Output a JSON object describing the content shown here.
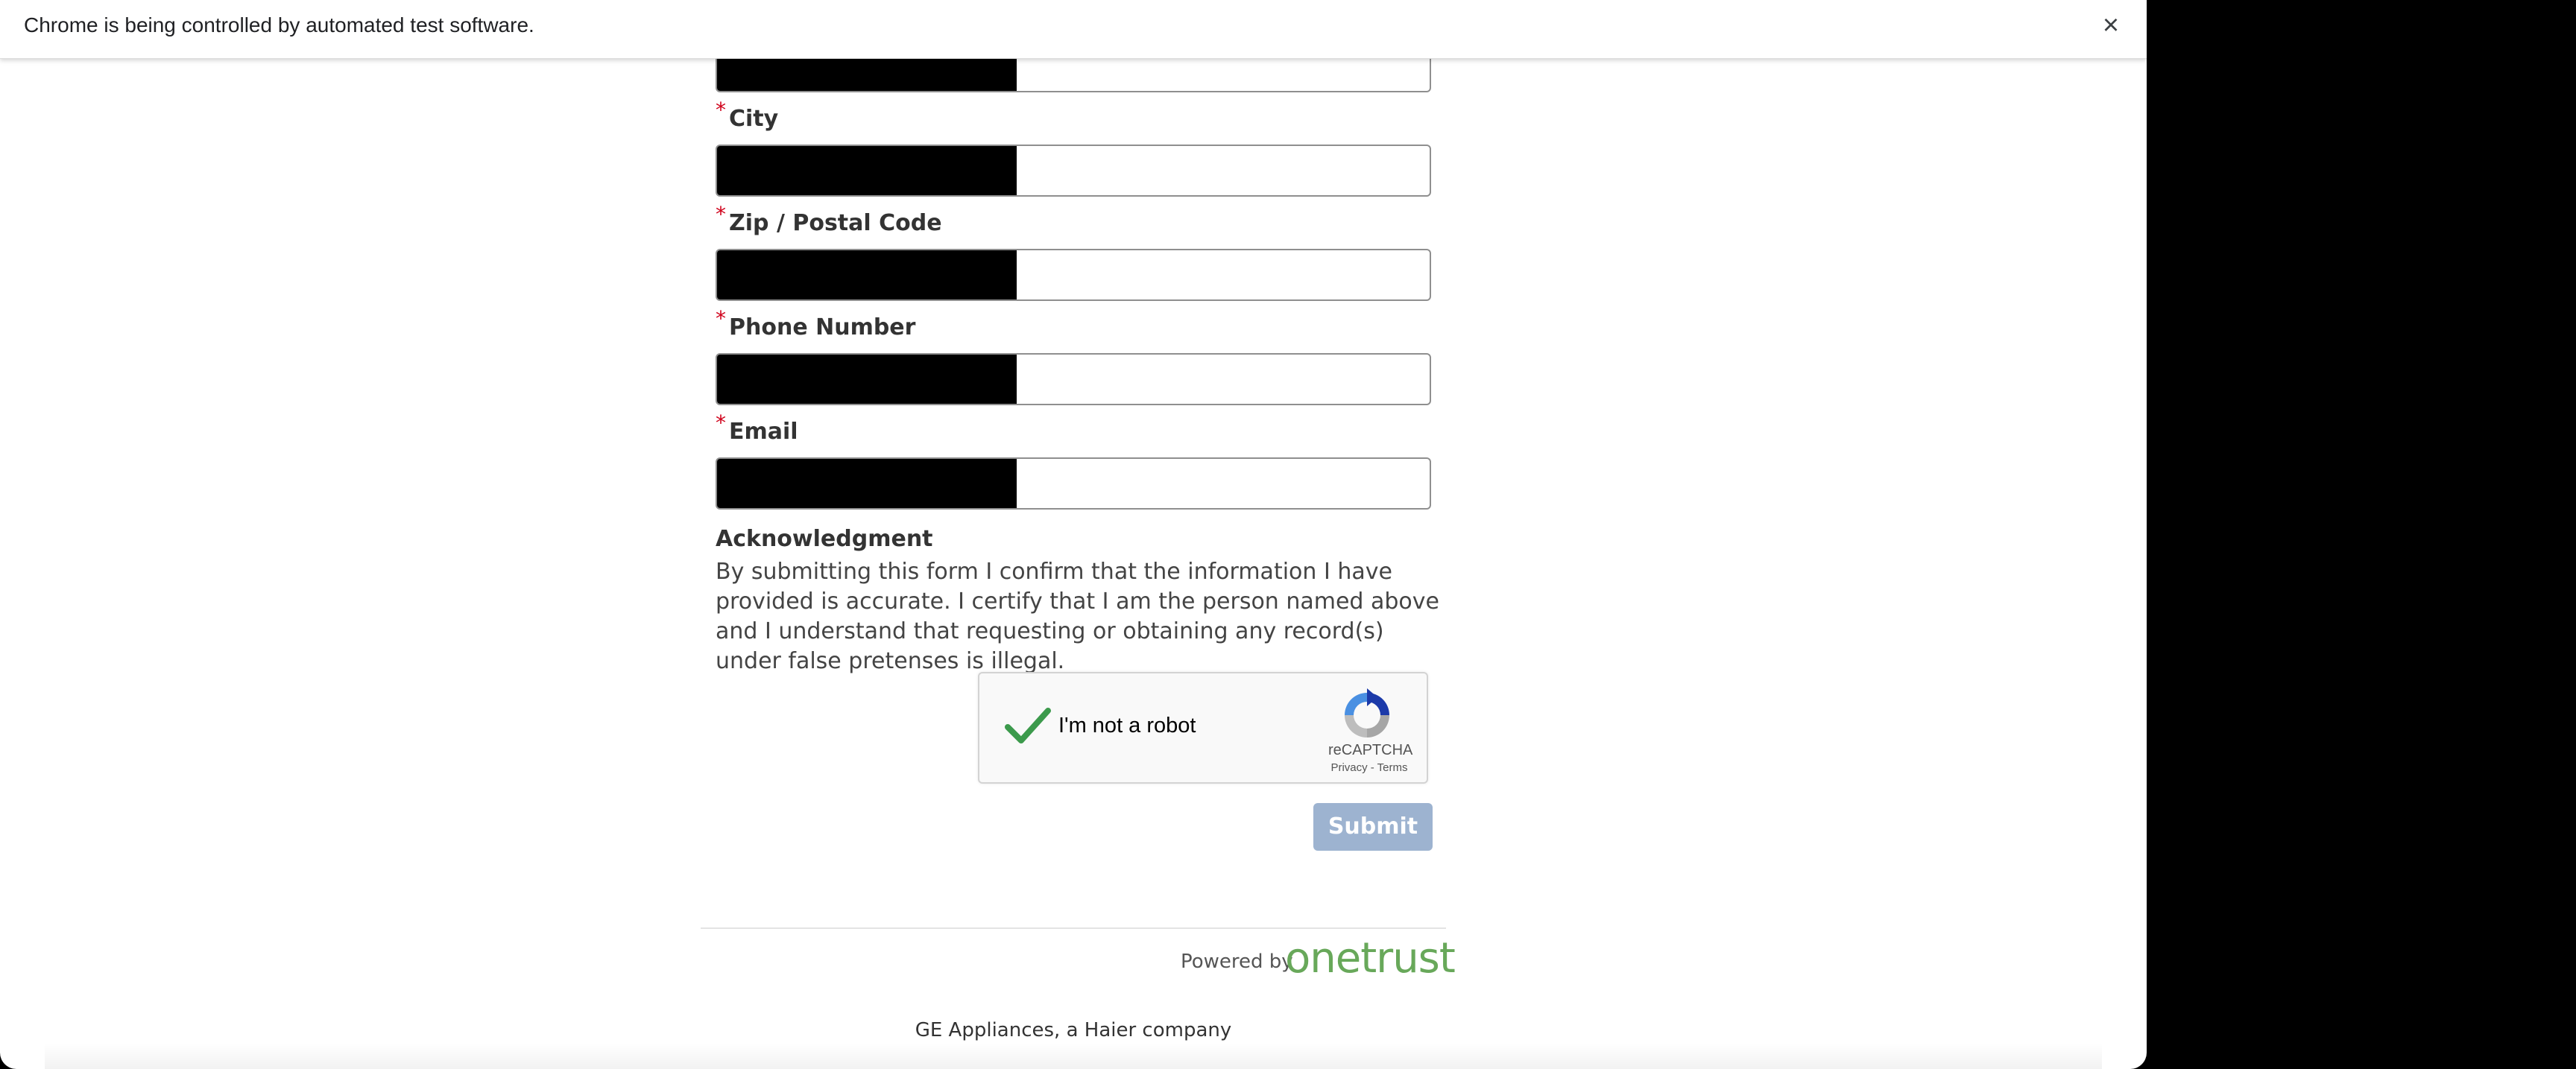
{
  "infobar": {
    "message": "Chrome is being controlled by automated test software.",
    "close_glyph": "×"
  },
  "form": {
    "required_marker": "*",
    "fields": [
      {
        "label": "",
        "value": ""
      },
      {
        "label": "City",
        "value": ""
      },
      {
        "label": "Zip / Postal Code",
        "value": ""
      },
      {
        "label": "Phone Number",
        "value": ""
      },
      {
        "label": "Email",
        "value": ""
      }
    ],
    "acknowledgment": {
      "title": "Acknowledgment",
      "text": "By submitting this form I confirm that the information I have provided is accurate. I certify that I am the person named above and I understand that requesting or obtaining any record(s) under false pretenses is illegal."
    },
    "recaptcha": {
      "label": "I'm not a robot",
      "brand": "reCAPTCHA",
      "links": "Privacy - Terms",
      "checked": true,
      "check_color": "#3c9a4c"
    },
    "submit_label": "Submit",
    "submit_color": "#9db3d0"
  },
  "branding": {
    "powered_by": "Powered by",
    "onetrust": "onetrust",
    "onetrust_color": "#68a85a"
  },
  "footer": {
    "company": "GE Appliances, a Haier company"
  }
}
